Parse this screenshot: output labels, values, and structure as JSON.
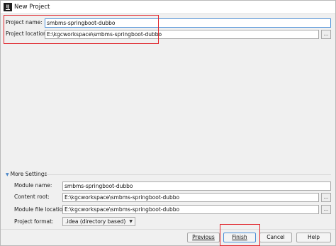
{
  "window": {
    "title": "New Project",
    "app_icon": "intellij-icon"
  },
  "project": {
    "name_label": "Project name:",
    "name_value": "smbms-springboot-dubbo",
    "location_label": "Project location:",
    "location_value": "E:\\kgcworkspace\\smbms-springboot-dubbo",
    "browse_label": "..."
  },
  "more_settings": {
    "header": "More Settings",
    "module_name_label": "Module name:",
    "module_name_value": "smbms-springboot-dubbo",
    "content_root_label": "Content root:",
    "content_root_value": "E:\\kgcworkspace\\smbms-springboot-dubbo",
    "module_file_location_label": "Module file location:",
    "module_file_location_value": "E:\\kgcworkspace\\smbms-springboot-dubbo",
    "project_format_label": "Project format:",
    "project_format_value": ".idea (directory based)",
    "browse_label": "..."
  },
  "buttons": {
    "previous": "Previous",
    "finish": "Finish",
    "cancel": "Cancel",
    "help": "Help"
  },
  "colors": {
    "highlight": "#e0242b",
    "focus": "#4d90d8"
  }
}
